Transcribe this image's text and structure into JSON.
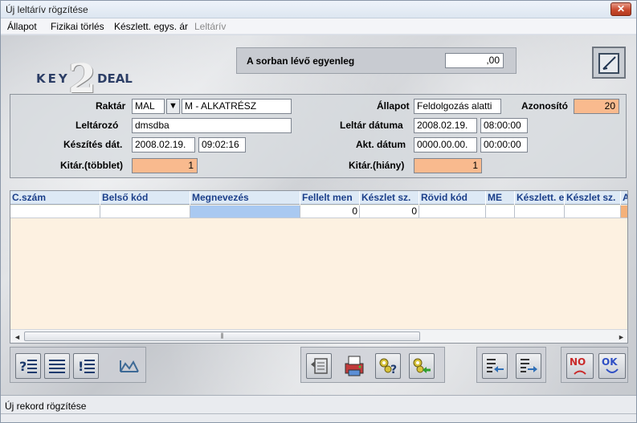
{
  "window": {
    "title": "Új leltárív rögzítése",
    "close_glyph": "✕"
  },
  "menu": [
    {
      "label": "Állapot",
      "disabled": false
    },
    {
      "label": "Fizikai törlés",
      "disabled": false
    },
    {
      "label": "Készlett. egys. ár",
      "disabled": false
    },
    {
      "label": "Leltárív",
      "disabled": true
    }
  ],
  "logo": {
    "key": "KEY",
    "two": "2",
    "deal": "DEAL"
  },
  "balance": {
    "label": "A sorban lévő egyenleg",
    "value": ",00"
  },
  "form": {
    "raktar": {
      "label": "Raktár",
      "code": "MAL",
      "name": "M - ALKATRÉSZ",
      "arrow_glyph": "▼"
    },
    "allapot": {
      "label": "Állapot",
      "value": "Feldolgozás alatti"
    },
    "azonosito": {
      "label": "Azonosító",
      "value": "20"
    },
    "leltarozo": {
      "label": "Leltározó",
      "value": "dmsdba"
    },
    "leltar_datuma": {
      "label": "Leltár dátuma",
      "date": "2008.02.19.",
      "time": "08:00:00"
    },
    "keszites_dat": {
      "label": "Készítés dát.",
      "date": "2008.02.19.",
      "time": "09:02:16"
    },
    "akt_datum": {
      "label": "Akt. dátum",
      "date": "0000.00.00.",
      "time": "00:00:00"
    },
    "kitar_tobblet": {
      "label": "Kitár.(többlet)",
      "value": "1"
    },
    "kitar_hiany": {
      "label": "Kitár.(hiány)",
      "value": "1"
    }
  },
  "grid": {
    "columns": [
      "C.szám",
      "Belső kód",
      "Megnevezés",
      "Fellelt men",
      "Készlet sz.",
      "Rövid kód",
      "ME",
      "Készlett. e",
      "Készlet sz.",
      "A"
    ],
    "rows": [
      [
        "",
        "",
        "",
        "0",
        "0",
        "",
        "",
        "",
        "",
        ""
      ]
    ],
    "scroll_left": "◄",
    "scroll_right": "►",
    "thumb_grip": "⫼"
  },
  "status": {
    "text": "Új rekord rögzítése"
  },
  "buttons": {
    "no": "NO",
    "ok": "OK"
  }
}
